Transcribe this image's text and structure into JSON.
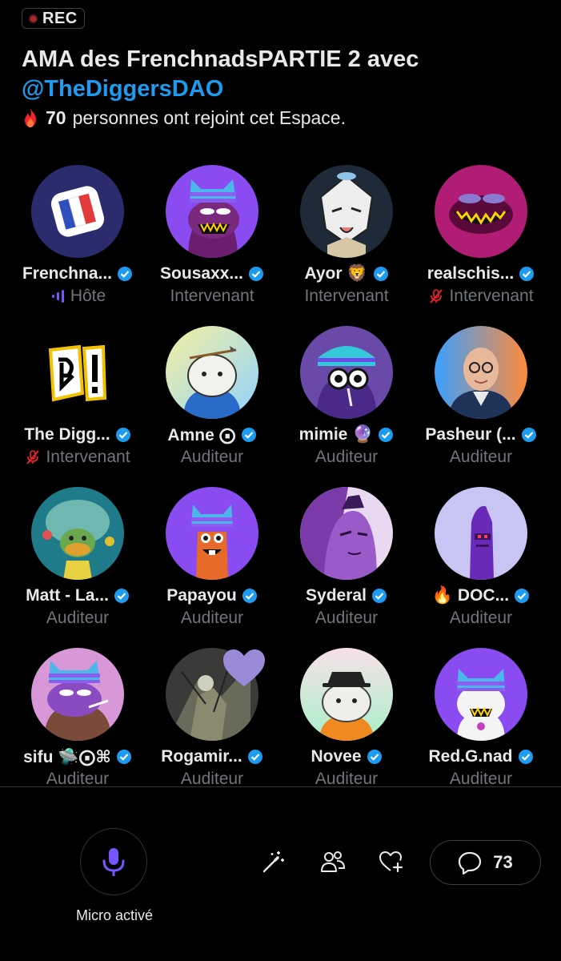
{
  "header": {
    "rec_label": "REC",
    "title": "AMA des FrenchnadsPARTIE 2 avec",
    "handle": "@TheDiggersDAO",
    "joined_count": "70",
    "joined_text": "personnes ont rejoint cet Espace."
  },
  "participants": [
    {
      "name": "Frenchna...",
      "role": "Hôte",
      "verified": true
    },
    {
      "name": "Sousaxx...",
      "role": "Intervenant",
      "verified": true
    },
    {
      "name": "Ayor 🦁",
      "role": "Intervenant",
      "verified": true
    },
    {
      "name": "realschis...",
      "role": "Intervenant",
      "verified": true,
      "muted": true
    },
    {
      "name": "The Digg...",
      "role": "Intervenant",
      "verified": true,
      "muted": true
    },
    {
      "name": "Amne ⨀",
      "role": "Auditeur",
      "verified": true
    },
    {
      "name": "mimie 🔮",
      "role": "Auditeur",
      "verified": true
    },
    {
      "name": "Pasheur (...",
      "role": "Auditeur",
      "verified": true
    },
    {
      "name": "Matt - La...",
      "role": "Auditeur",
      "verified": true
    },
    {
      "name": "Papayou",
      "role": "Auditeur",
      "verified": true
    },
    {
      "name": "Syderal",
      "role": "Auditeur",
      "verified": true
    },
    {
      "name": "🔥 DOC...",
      "role": "Auditeur",
      "verified": true
    },
    {
      "name": "sifu 🛸⨀⌘",
      "role": "Auditeur",
      "verified": true
    },
    {
      "name": "Rogamir...",
      "role": "Auditeur",
      "verified": true
    },
    {
      "name": "Novee",
      "role": "Auditeur",
      "verified": true
    },
    {
      "name": "Red.G.nad",
      "role": "Auditeur",
      "verified": true
    }
  ],
  "controls": {
    "mic_label": "Micro activé",
    "comment_count": "73"
  },
  "colors": {
    "accent": "#1d9bf0",
    "verified": "#1d9bf0",
    "mic": "#7856ff",
    "muted": "#f4212e",
    "secondary_text": "#71767b"
  }
}
